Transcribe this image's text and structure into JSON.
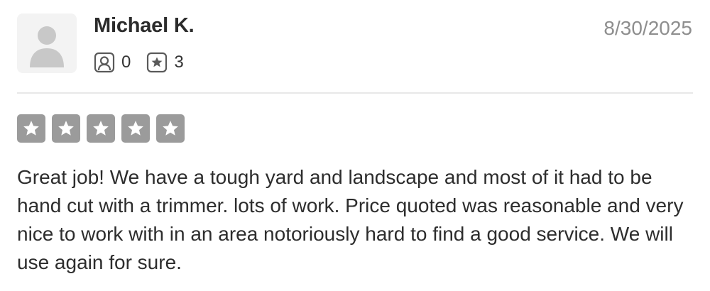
{
  "review": {
    "reviewer_name": "Michael K.",
    "date": "8/30/2025",
    "stats": {
      "reviews_count": "0",
      "photos_count": "3"
    },
    "rating": {
      "stars_filled": 5,
      "stars_total": 5
    },
    "text": "Great job! We have a tough yard and landscape and most of it had to be hand cut with a trimmer. lots of work. Price quoted was reasonable and very nice to work with in an area notoriously hard to find a good service. We will use again for sure."
  },
  "icons": {
    "avatar": "default-user-avatar",
    "reviews_stat": "user-profile-icon",
    "photos_stat": "star-badge-icon",
    "rating_star": "star-icon"
  },
  "colors": {
    "star_box": "#9b9b9b",
    "star_fill": "#ffffff",
    "date_text": "#8e8e8e",
    "divider": "#e8e8e8",
    "avatar_bg": "#f3f3f3",
    "avatar_silhouette": "#c8c8c8"
  }
}
